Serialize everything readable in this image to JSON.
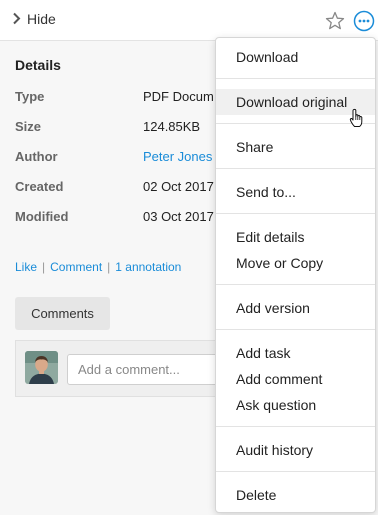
{
  "topbar": {
    "hide_label": "Hide"
  },
  "details": {
    "title": "Details",
    "props": [
      {
        "label": "Type",
        "value": "PDF Docum"
      },
      {
        "label": "Size",
        "value": "124.85KB"
      },
      {
        "label": "Author",
        "value": "Peter Jones"
      },
      {
        "label": "Created",
        "value": "02 Oct 2017"
      },
      {
        "label": "Modified",
        "value": "03 Oct 2017"
      }
    ]
  },
  "actions": {
    "like": "Like",
    "comment": "Comment",
    "annotations": "1 annotation"
  },
  "comments": {
    "button_label": "Comments",
    "input_placeholder": "Add a comment..."
  },
  "menu": {
    "items": [
      "Download",
      "Download original",
      "Share",
      "Send to...",
      "Edit details",
      "Move or Copy",
      "Add version",
      "Add task",
      "Add comment",
      "Ask question",
      "Audit history",
      "Delete"
    ],
    "hovered": "Download original"
  },
  "colors": {
    "link": "#1a8cd8",
    "menu_hover": "#f0f0f0",
    "background": "#f7f7f7"
  }
}
